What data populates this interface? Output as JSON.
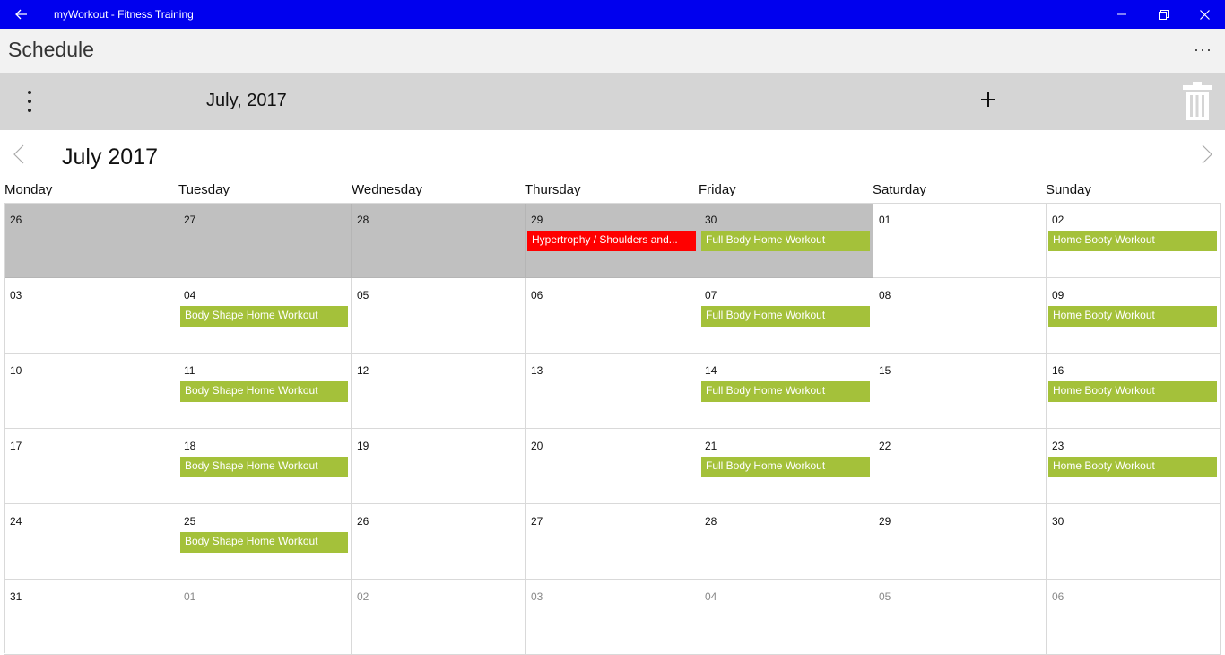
{
  "window": {
    "title": "myWorkout - Fitness Training"
  },
  "header": {
    "title": "Schedule",
    "more_label": "···"
  },
  "toolbar": {
    "month": "July, 2017"
  },
  "calendar": {
    "title": "July 2017",
    "days_of_week": [
      "Monday",
      "Tuesday",
      "Wednesday",
      "Thursday",
      "Friday",
      "Saturday",
      "Sunday"
    ],
    "weeks": [
      [
        {
          "day": "26",
          "state": "prev"
        },
        {
          "day": "27",
          "state": "prev"
        },
        {
          "day": "28",
          "state": "prev"
        },
        {
          "day": "29",
          "state": "prev",
          "event": "Hypertrophy / Shoulders and...",
          "event_color": "red"
        },
        {
          "day": "30",
          "state": "prev",
          "event": "Full Body Home Workout",
          "event_color": "green"
        },
        {
          "day": "01",
          "state": "current"
        },
        {
          "day": "02",
          "state": "current",
          "event": "Home Booty Workout",
          "event_color": "green"
        }
      ],
      [
        {
          "day": "03",
          "state": "current"
        },
        {
          "day": "04",
          "state": "current",
          "event": "Body Shape Home Workout",
          "event_color": "green"
        },
        {
          "day": "05",
          "state": "current"
        },
        {
          "day": "06",
          "state": "current"
        },
        {
          "day": "07",
          "state": "current",
          "event": "Full Body Home Workout",
          "event_color": "green"
        },
        {
          "day": "08",
          "state": "current"
        },
        {
          "day": "09",
          "state": "current",
          "event": "Home Booty Workout",
          "event_color": "green"
        }
      ],
      [
        {
          "day": "10",
          "state": "current"
        },
        {
          "day": "11",
          "state": "current",
          "event": "Body Shape Home Workout",
          "event_color": "green"
        },
        {
          "day": "12",
          "state": "current"
        },
        {
          "day": "13",
          "state": "current"
        },
        {
          "day": "14",
          "state": "current",
          "event": "Full Body Home Workout",
          "event_color": "green"
        },
        {
          "day": "15",
          "state": "current"
        },
        {
          "day": "16",
          "state": "current",
          "event": "Home Booty Workout",
          "event_color": "green"
        }
      ],
      [
        {
          "day": "17",
          "state": "current"
        },
        {
          "day": "18",
          "state": "current",
          "event": "Body Shape Home Workout",
          "event_color": "green"
        },
        {
          "day": "19",
          "state": "current"
        },
        {
          "day": "20",
          "state": "current"
        },
        {
          "day": "21",
          "state": "current",
          "event": "Full Body Home Workout",
          "event_color": "green"
        },
        {
          "day": "22",
          "state": "current"
        },
        {
          "day": "23",
          "state": "current",
          "event": "Home Booty Workout",
          "event_color": "green"
        }
      ],
      [
        {
          "day": "24",
          "state": "current"
        },
        {
          "day": "25",
          "state": "current",
          "event": "Body Shape Home Workout",
          "event_color": "green"
        },
        {
          "day": "26",
          "state": "current"
        },
        {
          "day": "27",
          "state": "current"
        },
        {
          "day": "28",
          "state": "current"
        },
        {
          "day": "29",
          "state": "current"
        },
        {
          "day": "30",
          "state": "current"
        }
      ],
      [
        {
          "day": "31",
          "state": "current"
        },
        {
          "day": "01",
          "state": "next"
        },
        {
          "day": "02",
          "state": "next"
        },
        {
          "day": "03",
          "state": "next"
        },
        {
          "day": "04",
          "state": "next"
        },
        {
          "day": "05",
          "state": "next"
        },
        {
          "day": "06",
          "state": "next"
        }
      ]
    ]
  },
  "colors": {
    "titlebar": "#0000ee",
    "event_green": "#a4c13a",
    "event_red": "#ff0000",
    "prev_month_cell": "#c0c0c0"
  },
  "icons": {
    "back": "back-arrow-icon",
    "minimize": "minimize-icon",
    "restore": "restore-icon",
    "close": "close-icon",
    "menu": "kebab-menu-icon",
    "add": "plus-icon",
    "delete": "trash-icon",
    "prev": "chevron-left-icon",
    "next": "chevron-right-icon"
  }
}
